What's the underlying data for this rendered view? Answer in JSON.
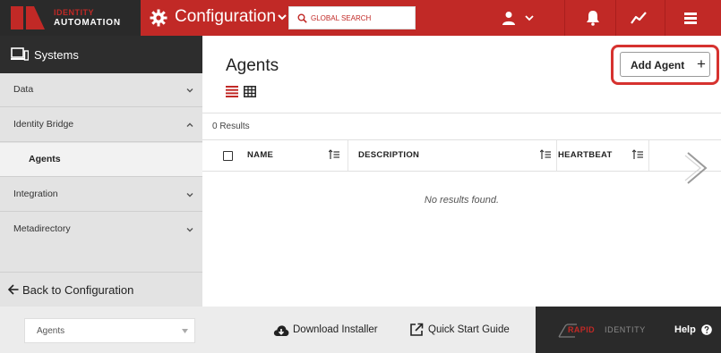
{
  "header": {
    "logo_top": "IDENTITY",
    "logo_bottom": "AUTOMATION",
    "app_title": "Configuration",
    "search_placeholder": "GLOBAL SEARCH",
    "brand_color": "#c12926"
  },
  "sidebar": {
    "section_title": "Systems",
    "items": [
      {
        "label": "Data",
        "chevron": "chevron-down-icon"
      },
      {
        "label": "Identity Bridge",
        "chevron": "chevron-up-icon"
      },
      {
        "label": "Agents",
        "active": true
      },
      {
        "label": "Integration",
        "chevron": "chevron-down-icon"
      },
      {
        "label": "Metadirectory",
        "chevron": "chevron-down-icon"
      }
    ],
    "back_label": "Back to Configuration"
  },
  "main": {
    "title": "Agents",
    "add_button_label": "Add Agent",
    "add_button_icon": "+",
    "results_text": "0 Results",
    "table": {
      "columns": [
        "NAME",
        "DESCRIPTION",
        "HEARTBEAT"
      ],
      "rows": []
    },
    "empty_text": "No results found."
  },
  "footer": {
    "selected_view": "Agents",
    "download_label": "Download Installer",
    "quick_start_label": "Quick Start Guide",
    "brand_part1": "RAPID",
    "brand_part2": "IDENTITY",
    "help_label": "Help"
  }
}
